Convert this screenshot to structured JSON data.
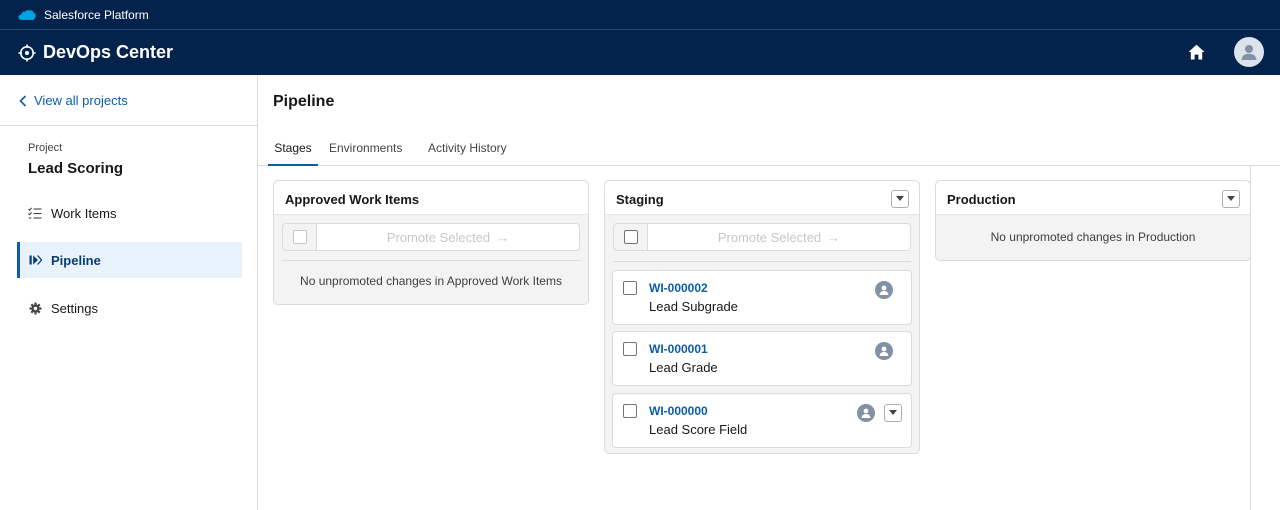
{
  "system_bar": {
    "title": "Salesforce Platform"
  },
  "app_header": {
    "title": "DevOps Center"
  },
  "sidebar": {
    "back_link": "View all projects",
    "project_label": "Project",
    "project_name": "Lead Scoring",
    "items": [
      {
        "label": "Work Items",
        "icon": "checklist-icon",
        "active": false
      },
      {
        "label": "Pipeline",
        "icon": "pipeline-icon",
        "active": true
      },
      {
        "label": "Settings",
        "icon": "gear-icon",
        "active": false
      }
    ]
  },
  "main": {
    "title": "Pipeline",
    "tabs": [
      {
        "label": "Stages",
        "active": true
      },
      {
        "label": "Environments",
        "active": false
      },
      {
        "label": "Activity History",
        "active": false
      }
    ]
  },
  "stages": [
    {
      "title": "Approved Work Items",
      "promote_label": "Promote Selected",
      "promote_arrow": "→",
      "empty_message": "No unpromoted changes in Approved Work Items"
    },
    {
      "title": "Staging",
      "promote_label": "Promote Selected",
      "promote_arrow": "→",
      "work_items": [
        {
          "id": "WI-000002",
          "name": "Lead Subgrade"
        },
        {
          "id": "WI-000001",
          "name": "Lead Grade"
        },
        {
          "id": "WI-000000",
          "name": "Lead Score Field"
        }
      ]
    },
    {
      "title": "Production",
      "empty_message": "No unpromoted changes in Production"
    }
  ],
  "colors": {
    "header_bg": "#03234d",
    "link": "#0b5cab",
    "active_nav_bg": "#e8f2fb"
  }
}
